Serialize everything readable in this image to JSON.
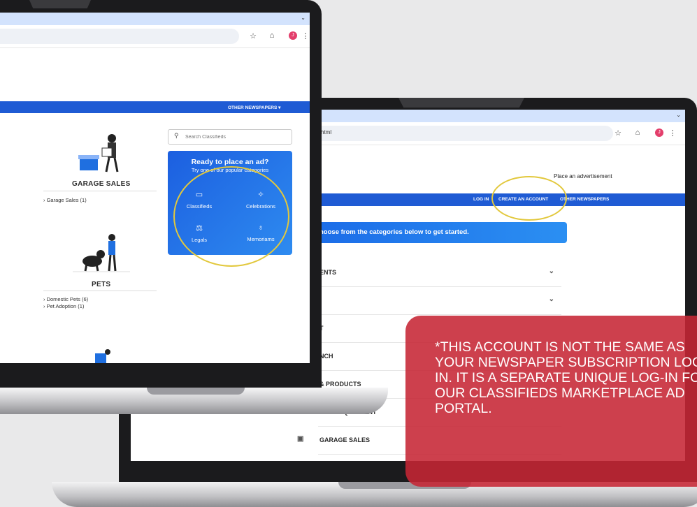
{
  "front": {
    "nav_label": "OTHER NEWSPAPERS ▾",
    "search_placeholder": "Search Classifieds",
    "ad_panel": {
      "title": "Ready to place an ad?",
      "subtitle": "Try one of our popular categories",
      "options": [
        "Classifieds",
        "Celebrations",
        "Legals",
        "Memoriams"
      ]
    },
    "categories": [
      {
        "title": "GARAGE SALES",
        "links": [
          "› Garage Sales (1)"
        ]
      },
      {
        "title": "PETS",
        "links": [
          "› Domestic Pets (6)",
          "› Pet Adoption (1)"
        ]
      }
    ]
  },
  "back": {
    "url": "i.html",
    "place_ad": "Place an advertisement",
    "nav": {
      "login": "LOG IN",
      "create": "CREATE AN ACCOUNT",
      "other": "OTHER NEWSPAPERS"
    },
    "banner": "hoose from the categories below to get started.",
    "rows": [
      "ENTS",
      "",
      "T",
      "NCH",
      "& PRODUCTS",
      "FARM EQUIPMENT",
      "GARAGE SALES"
    ]
  },
  "notice": "*THIS ACCOUNT IS NOT THE SAME AS YOUR NEWSPAPER SUBSCRIPTION LOG IN. IT IS A SEPARATE UNIQUE LOG-IN FOR OUR CLASSIFIEDS MARKETPLACE AD PORTAL.",
  "colors": {
    "brand_blue": "#1f5bd4",
    "highlight_ring": "#e2c83c",
    "notice_red": "#c62634"
  },
  "icons": [
    "star-icon",
    "extension-icon",
    "profile-avatar-icon",
    "kebab-menu-icon",
    "search-icon",
    "chevron-down-icon"
  ]
}
